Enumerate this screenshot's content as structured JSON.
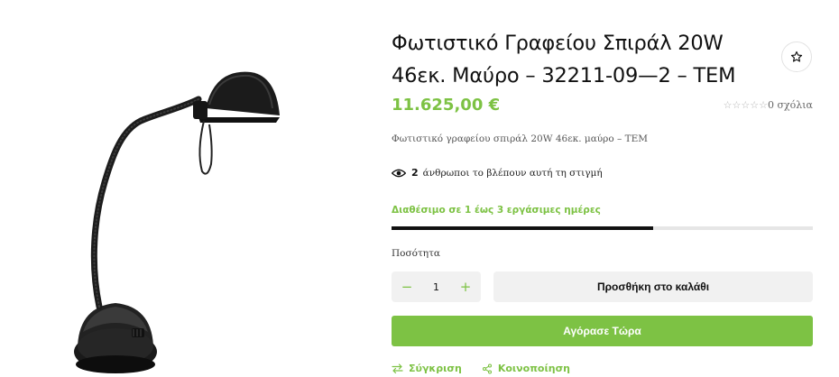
{
  "product": {
    "title": "Φωτιστικό Γραφείου Σπιράλ 20W 46εκ. Μαύρο – 32211-09—2 – TEM",
    "price": "11.625,00 €",
    "rating_stars": "☆☆☆☆☆",
    "reviews_label": "0 σχόλια",
    "short_description": "Φωτιστικό γραφείου σπιράλ 20W 46εκ. μαύρο – TEM"
  },
  "viewers": {
    "count": "2",
    "text": "άνθρωποι το βλέπουν αυτή τη στιγμή"
  },
  "availability": {
    "text": "Διαθέσιμο σε 1 έως 3 εργάσιμες ημέρες",
    "stock_level_percent": 62
  },
  "quantity": {
    "label": "Ποσότητα",
    "value": "1",
    "minus": "−",
    "plus": "+"
  },
  "buttons": {
    "add_to_cart": "Προσθήκη στο καλάθι",
    "buy_now": "Αγόρασε Τώρα"
  },
  "actions": {
    "compare": "Σύγκριση",
    "share": "Κοινοποίηση"
  },
  "icons": {
    "wishlist": "star-icon",
    "viewers": "eye-icon",
    "compare": "compare-arrows-icon",
    "share": "share-icon"
  },
  "colors": {
    "accent": "#7dc244",
    "dark": "#111111",
    "light_button": "#f1f1f1"
  }
}
